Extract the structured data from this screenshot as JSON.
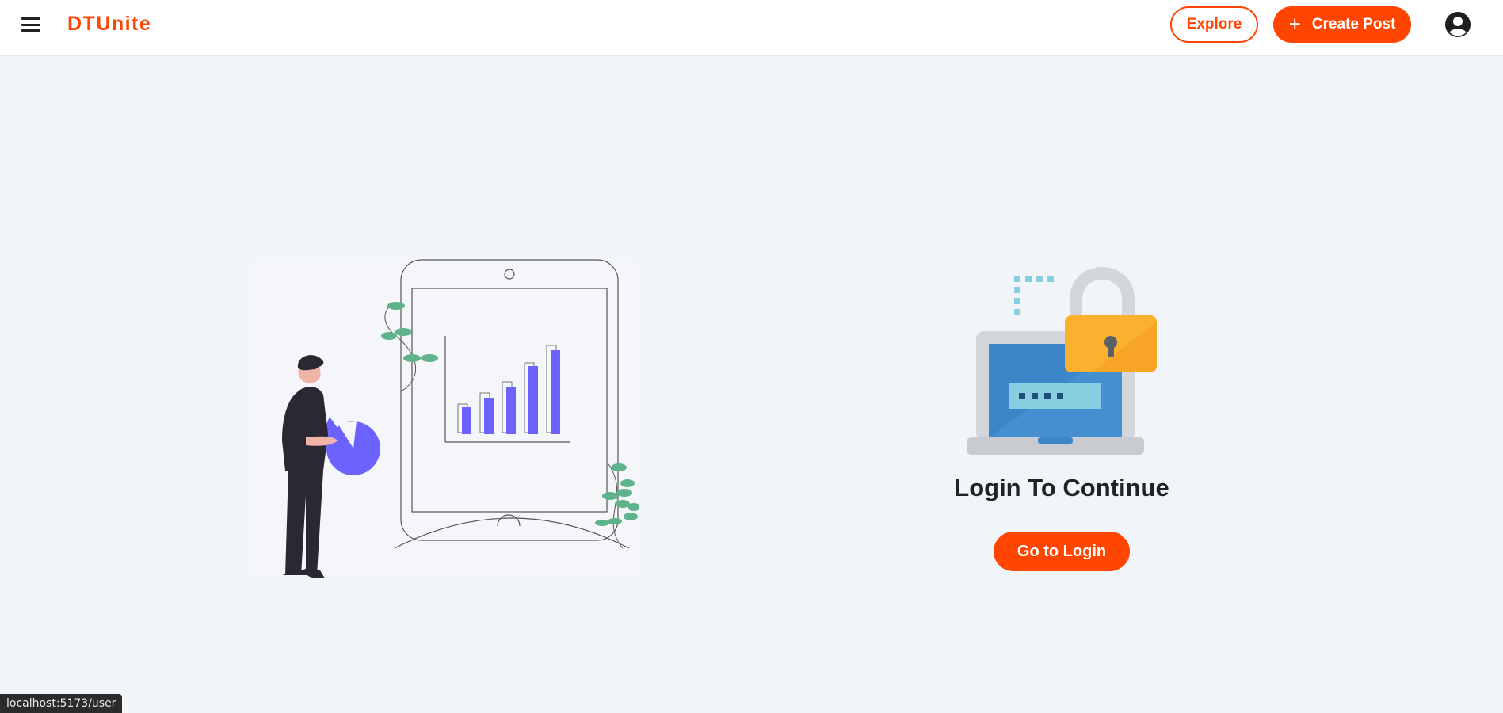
{
  "navbar": {
    "brand": "DTUnite",
    "menu_icon": "hamburger-menu-icon",
    "explore_label": "Explore",
    "create_post_label": "Create Post",
    "create_post_icon": "plus-icon",
    "profile_icon": "user-circle-icon"
  },
  "main": {
    "left_illustration": "person-with-tablet-chart-illustration",
    "lock_illustration": "laptop-padlock-illustration",
    "title": "Login To Continue",
    "login_button_label": "Go to Login"
  },
  "status_bar": {
    "url": "localhost:5173/user"
  },
  "colors": {
    "accent": "#ff4500",
    "background": "#f1f4f8",
    "chart_purple": "#6c63ff",
    "leaf_green": "#5fb38a"
  }
}
